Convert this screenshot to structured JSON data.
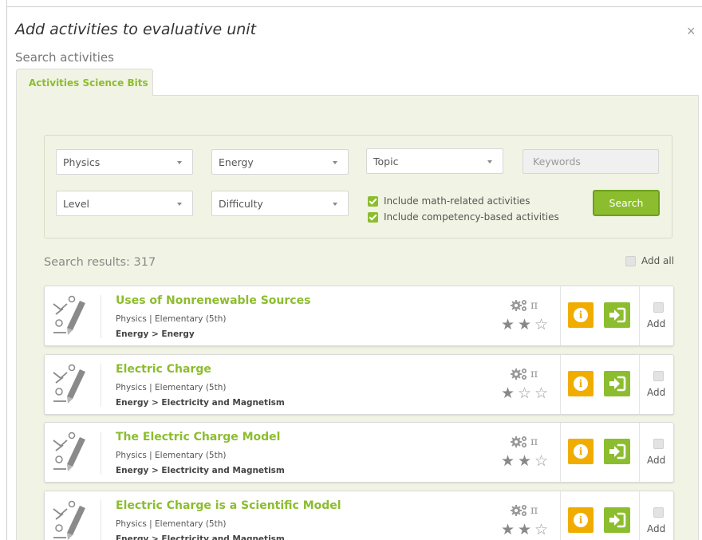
{
  "dialog": {
    "title": "Add activities to evaluative unit",
    "close_symbol": "×"
  },
  "search_label": "Search activities",
  "tab": {
    "label": "Activities Science Bits"
  },
  "filters": {
    "subject": "Physics",
    "unit": "Energy",
    "topic": "Topic",
    "keywords_placeholder": "Keywords",
    "level": "Level",
    "difficulty": "Difficulty",
    "include_math_label": "Include math-related activities",
    "include_math_checked": true,
    "include_competency_label": "Include competency-based activities",
    "include_competency_checked": true,
    "search_button": "Search"
  },
  "results": {
    "label": "Search results: 317",
    "add_all_label": "Add all",
    "items": [
      {
        "title": "Uses of Nonrenewable Sources",
        "meta": "Physics | Elementary (5th)",
        "path": "Energy > Energy",
        "pi": "π",
        "rating": 2,
        "add_label": "Add"
      },
      {
        "title": "Electric Charge",
        "meta": "Physics | Elementary (5th)",
        "path": "Energy > Electricity and Magnetism",
        "pi": "π",
        "rating": 1,
        "add_label": "Add"
      },
      {
        "title": "The Electric Charge Model",
        "meta": "Physics | Elementary (5th)",
        "path": "Energy > Electricity and Magnetism",
        "pi": "π",
        "rating": 2,
        "add_label": "Add"
      },
      {
        "title": "Electric Charge is a Scientific Model",
        "meta": "Physics | Elementary (5th)",
        "path": "Energy > Electricity and Magnetism",
        "pi": "π",
        "rating": 2,
        "add_label": "Add"
      }
    ]
  },
  "colors": {
    "accent_green": "#8cbd2f",
    "info_orange": "#f0ad00",
    "panel_bg": "#f1f4e4"
  },
  "icons": {
    "close": "close-icon",
    "thumbnail": "activity-pencil-icon",
    "gears": "gears-icon",
    "star_filled": "star-filled-icon",
    "star_empty": "star-empty-icon",
    "info": "info-icon",
    "open": "enter-arrow-icon",
    "checkbox": "checkbox-icon"
  }
}
